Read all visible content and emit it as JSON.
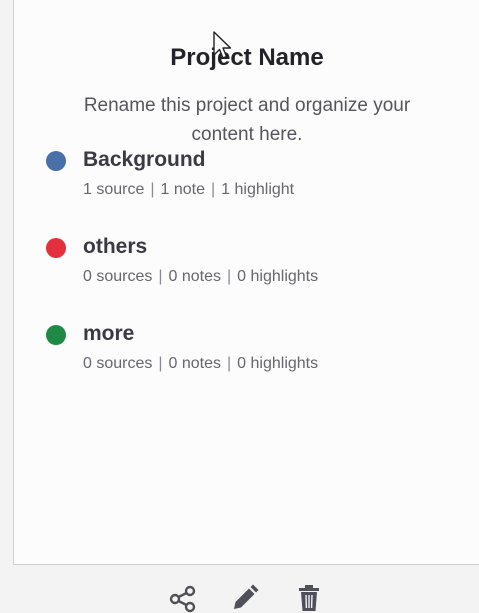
{
  "project": {
    "title": "Project Name",
    "description": "Rename this project and organize your content here."
  },
  "categories": [
    {
      "name": "Background",
      "color": "#4a70aa",
      "sources": "1 source",
      "notes": "1 note",
      "highlights": "1 highlight"
    },
    {
      "name": "others",
      "color": "#e3303e",
      "sources": "0 sources",
      "notes": "0 notes",
      "highlights": "0 highlights"
    },
    {
      "name": "more",
      "color": "#1e8a46",
      "sources": "0 sources",
      "notes": "0 notes",
      "highlights": "0 highlights"
    }
  ],
  "stats_separator": "|",
  "toolbar": {
    "icons": [
      "share-icon",
      "pencil-icon",
      "trash-icon"
    ]
  }
}
